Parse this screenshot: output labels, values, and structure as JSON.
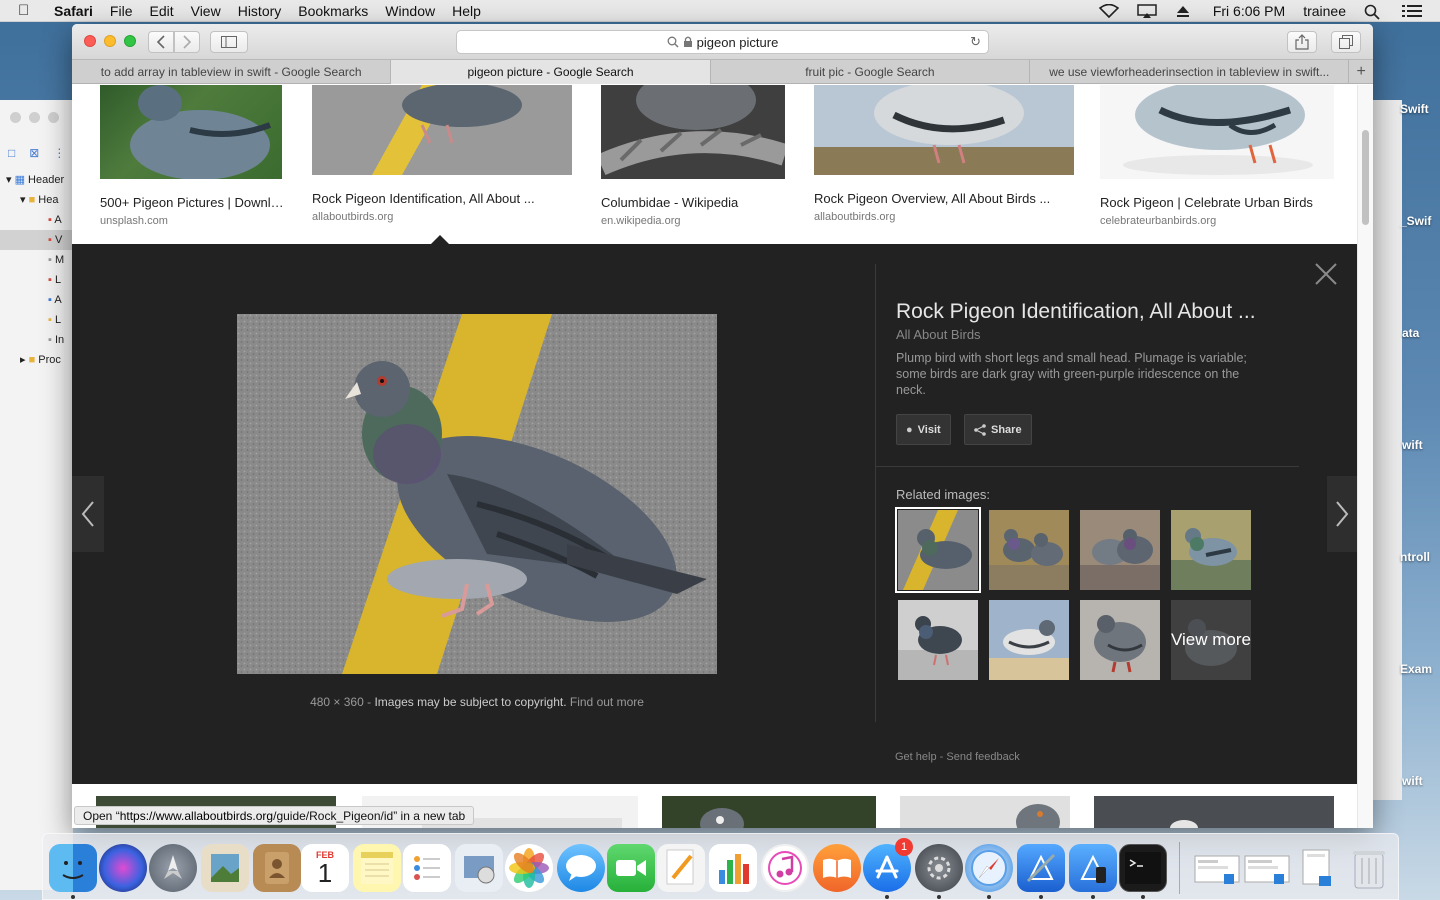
{
  "menubar": {
    "app": "Safari",
    "items": [
      "File",
      "Edit",
      "View",
      "History",
      "Bookmarks",
      "Window",
      "Help"
    ],
    "clock": "Fri 6:06 PM",
    "user": "trainee"
  },
  "xcode": {
    "tree": [
      "Header",
      "Hea",
      "A",
      "V",
      "M",
      "L",
      "A",
      "L",
      "In",
      "Proc"
    ],
    "right_labels": [
      "Swift",
      "_Swif",
      "ata",
      "wift",
      "ntroll",
      "Exam",
      "wift"
    ]
  },
  "safari": {
    "address": "pigeon picture",
    "tabs": [
      "to add array in tableview in swift - Google Search",
      "pigeon picture - Google Search",
      "fruit pic - Google Search",
      "we use viewforheaderinsection in tableview in swift..."
    ],
    "status_prefix": "Open “",
    "status_url": "https://www.allaboutbirds.org",
    "status_suffix": "/guide/Rock_Pigeon/id” in a new tab"
  },
  "results": [
    {
      "title": "500+ Pigeon Pictures | Downl…",
      "domain": "unsplash.com"
    },
    {
      "title": "Rock Pigeon Identification, All About ...",
      "domain": "allaboutbirds.org"
    },
    {
      "title": "Columbidae - Wikipedia",
      "domain": "en.wikipedia.org"
    },
    {
      "title": "Rock Pigeon Overview, All About Birds ...",
      "domain": "allaboutbirds.org"
    },
    {
      "title": "Rock Pigeon | Celebrate Urban Birds",
      "domain": "celebrateurbanbirds.org"
    }
  ],
  "panel": {
    "title": "Rock Pigeon Identification, All About ...",
    "site": "All About Birds",
    "description": "Plump bird with short legs and small head. Plumage is variable; some birds are dark gray with green-purple iridescence on the neck.",
    "visit_label": "Visit",
    "share_label": "Share",
    "related_label": "Related images:",
    "view_more": "View more",
    "dimensions": "480 × 360",
    "sep": " - ",
    "copyright": "Images may be subject to copyright.",
    "find_out_more": "Find out more",
    "get_help": "Get help",
    "dot": " - ",
    "send_feedback": "Send feedback"
  },
  "dock": {
    "calendar_month": "FEB",
    "calendar_day": "1",
    "appstore_badge": "1"
  },
  "colors": {
    "panel_bg": "#222222",
    "link": "#999999",
    "badge": "#f03a32"
  }
}
